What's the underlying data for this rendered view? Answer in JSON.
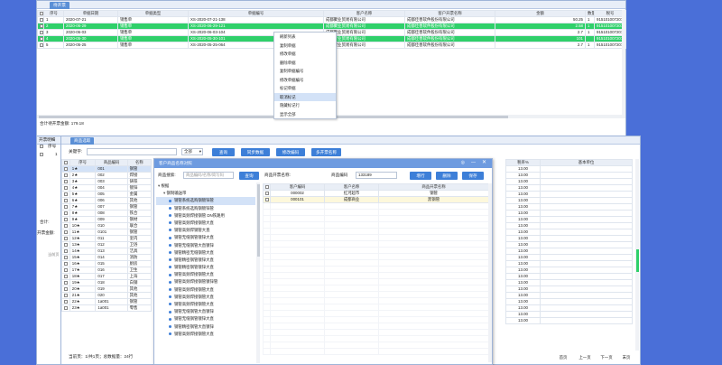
{
  "top_window": {
    "tab_label": "待开票",
    "columns": [
      "序号",
      "单据日期",
      "单据类型",
      "单据编号",
      "客户名称",
      "客户开票名称",
      "金额",
      "数量",
      "税号"
    ],
    "rows": [
      {
        "no": "1",
        "date": "2020-07-21",
        "type": "销售单",
        "code": "XS-2020-07-21-138",
        "customer": "成都聚业贸易有限公司",
        "invoice_name": "成都佳善软件股份有限公司",
        "amount": "50.25",
        "qty": "1",
        "tax": "915101007207666JF",
        "style": "normal"
      },
      {
        "no": "2",
        "date": "2020-06-29",
        "type": "销售单",
        "code": "XS-2020-06-29-121",
        "customer": "成都聚业贸易有限公司",
        "invoice_name": "成都佳善软件股份有限公司",
        "amount": "2.58",
        "qty": "1",
        "tax": "915101007207666JF",
        "style": "sel"
      },
      {
        "no": "3",
        "date": "2020-06-03",
        "type": "销售单",
        "code": "XS-2020-06-03-104",
        "customer": "成都聚业贸易有限公司",
        "invoice_name": "成都佳善软件股份有限公司",
        "amount": "2.7",
        "qty": "1",
        "tax": "915101007207666JF",
        "style": "normal"
      },
      {
        "no": "4",
        "date": "2020-05-30",
        "type": "销售单",
        "code": "XS-2020-05-30-101",
        "customer": "成都聚业贸易有限公司",
        "invoice_name": "成都佳善软件股份有限公司",
        "amount": "101",
        "qty": "",
        "tax": "915101007207666JF",
        "style": "sel"
      },
      {
        "no": "5",
        "date": "2020-05-25",
        "type": "销售单",
        "code": "XS-2020-05-25-064",
        "customer": "成都聚业贸易有限公司",
        "invoice_name": "成都佳善软件股份有限公司",
        "amount": "2.7",
        "qty": "1",
        "tax": "915101007207666JF",
        "style": "normal"
      }
    ],
    "summary": "合计待开票金额: 179.18"
  },
  "context_menu": {
    "items": [
      "刷新列表",
      "复制单据",
      "修改单据",
      "删除单据",
      "复制单据编号",
      "修改单据编号",
      "标记单据",
      "取消标记",
      "隐藏标记行",
      "显示全部"
    ],
    "highlighted_index": 7
  },
  "left_panel": {
    "header_label": "开票明细",
    "col_no": "序号",
    "row1_no": "1",
    "total_label": "合计:",
    "invoice_amount_label": "开票金额:",
    "bottom_btn": "当前页"
  },
  "product_window": {
    "tab_label": "商品选取",
    "keyword_label": "关键字:",
    "select_value": "全部",
    "query_btn": "查询",
    "sync_btn": "同步数据",
    "change_code_btn": "修改编码",
    "multi_btn": "多开票名称",
    "columns": [
      "序号",
      "商品编码",
      "名称"
    ],
    "rows": [
      {
        "no": "1★",
        "code": "001",
        "name": "钢管"
      },
      {
        "no": "2★",
        "code": "002",
        "name": "焊接"
      },
      {
        "no": "3★",
        "code": "003",
        "name": "铸铁"
      },
      {
        "no": "4★",
        "code": "004",
        "name": "镀锌"
      },
      {
        "no": "5★",
        "code": "005",
        "name": "金属"
      },
      {
        "no": "6★",
        "code": "006",
        "name": "其他"
      },
      {
        "no": "7★",
        "code": "007",
        "name": "钢管"
      },
      {
        "no": "8★",
        "code": "008",
        "name": "铁合"
      },
      {
        "no": "9★",
        "code": "009",
        "name": "钢材"
      },
      {
        "no": "10★",
        "code": "010",
        "name": "联合"
      },
      {
        "no": "11★",
        "code": "0101",
        "name": "钢管"
      },
      {
        "no": "12★",
        "code": "011",
        "name": "室内"
      },
      {
        "no": "13★",
        "code": "012",
        "name": "卫浴"
      },
      {
        "no": "14★",
        "code": "013",
        "name": "洁具"
      },
      {
        "no": "15★",
        "code": "014",
        "name": "消防"
      },
      {
        "no": "16★",
        "code": "015",
        "name": "厨房"
      },
      {
        "no": "17★",
        "code": "016",
        "name": "卫生"
      },
      {
        "no": "18★",
        "code": "017",
        "name": "上海"
      },
      {
        "no": "19★",
        "code": "018",
        "name": "白钢"
      },
      {
        "no": "20★",
        "code": "019",
        "name": "其他"
      },
      {
        "no": "21★",
        "code": "020",
        "name": "其他"
      },
      {
        "no": "22★",
        "code": "1a001",
        "name": "钢管"
      },
      {
        "no": "23★",
        "code": "1a001",
        "name": "零售"
      }
    ],
    "pager_text": "当前页：1/共1页；总数据量：24行",
    "right_columns": [
      "税率%",
      "基本单位"
    ],
    "tax_values": [
      "13.00",
      "13.00",
      "13.00",
      "13.00",
      "13.00",
      "13.00",
      "13.00",
      "13.00",
      "13.00",
      "13.00",
      "13.00",
      "13.00",
      "13.00",
      "13.00",
      "13.00",
      "13.00",
      "13.00",
      "13.00",
      "13.00",
      "13.00",
      "13.00",
      "13.00",
      "13.00",
      "13.00",
      "13.00"
    ],
    "pager_buttons": [
      "首页",
      "上一页",
      "下一页",
      "末页"
    ]
  },
  "mapping_dialog": {
    "title": "客户商品名称对照",
    "product_label": "商品搜索:",
    "product_placeholder": "商品编码/名称/简写码",
    "search_btn": "查询",
    "invoice_label": "商品开票名称:",
    "code_label": "商品编码",
    "code_value": "133189",
    "add_btn": "增行",
    "del_btn": "删除",
    "save_btn": "保存",
    "tree": [
      {
        "label": "根据",
        "indent": 0,
        "icon": "expand"
      },
      {
        "label": "钢制输送带",
        "indent": 1,
        "icon": "expand"
      },
      {
        "label": "钢管系统选购钢镀锌管",
        "indent": 2,
        "icon": "dot",
        "selected": true
      },
      {
        "label": "钢管系统选购钢镀锌管",
        "indent": 2,
        "icon": "dot"
      },
      {
        "label": "钢管高频焊接钢管 DN铁路用",
        "indent": 2,
        "icon": "dot"
      },
      {
        "label": "钢管高频焊接钢管大直",
        "indent": 2,
        "icon": "dot"
      },
      {
        "label": "钢管高频焊钢管大直",
        "indent": 2,
        "icon": "dot"
      },
      {
        "label": "钢管无缝钢管镀锌大直",
        "indent": 2,
        "icon": "dot"
      },
      {
        "label": "钢管无缝钢管大直镀锌",
        "indent": 2,
        "icon": "dot"
      },
      {
        "label": "钢管精密无缝钢管大直",
        "indent": 2,
        "icon": "dot"
      },
      {
        "label": "钢管精密钢管镀锌大直",
        "indent": 2,
        "icon": "dot"
      },
      {
        "label": "钢管精密钢管镀锌大直",
        "indent": 2,
        "icon": "dot"
      },
      {
        "label": "钢管高频焊接钢管大直",
        "indent": 2,
        "icon": "dot"
      },
      {
        "label": "钢管高频焊接钢管镀锌管",
        "indent": 2,
        "icon": "dot"
      },
      {
        "label": "钢管高频焊接钢管大直",
        "indent": 2,
        "icon": "dot"
      },
      {
        "label": "钢管高频焊接钢管大直",
        "indent": 2,
        "icon": "dot"
      },
      {
        "label": "钢管高频焊接钢管大直",
        "indent": 2,
        "icon": "dot"
      },
      {
        "label": "钢管无缝钢管大直镀锌",
        "indent": 2,
        "icon": "dot"
      },
      {
        "label": "钢管无缝钢管镀锌大直",
        "indent": 2,
        "icon": "dot"
      },
      {
        "label": "钢管精密钢管大直镀锌",
        "indent": 2,
        "icon": "dot"
      },
      {
        "label": "钢管高频焊接钢管大直",
        "indent": 2,
        "icon": "dot"
      }
    ],
    "grid_columns": [
      "客户编码",
      "客户名称",
      "商品开票名称"
    ],
    "grid_rows": [
      {
        "code": "000002",
        "name": "红河超市",
        "invoice": "钢管"
      },
      {
        "code": "000101",
        "name": "成都商业",
        "invoice": "黑钢管"
      }
    ]
  }
}
